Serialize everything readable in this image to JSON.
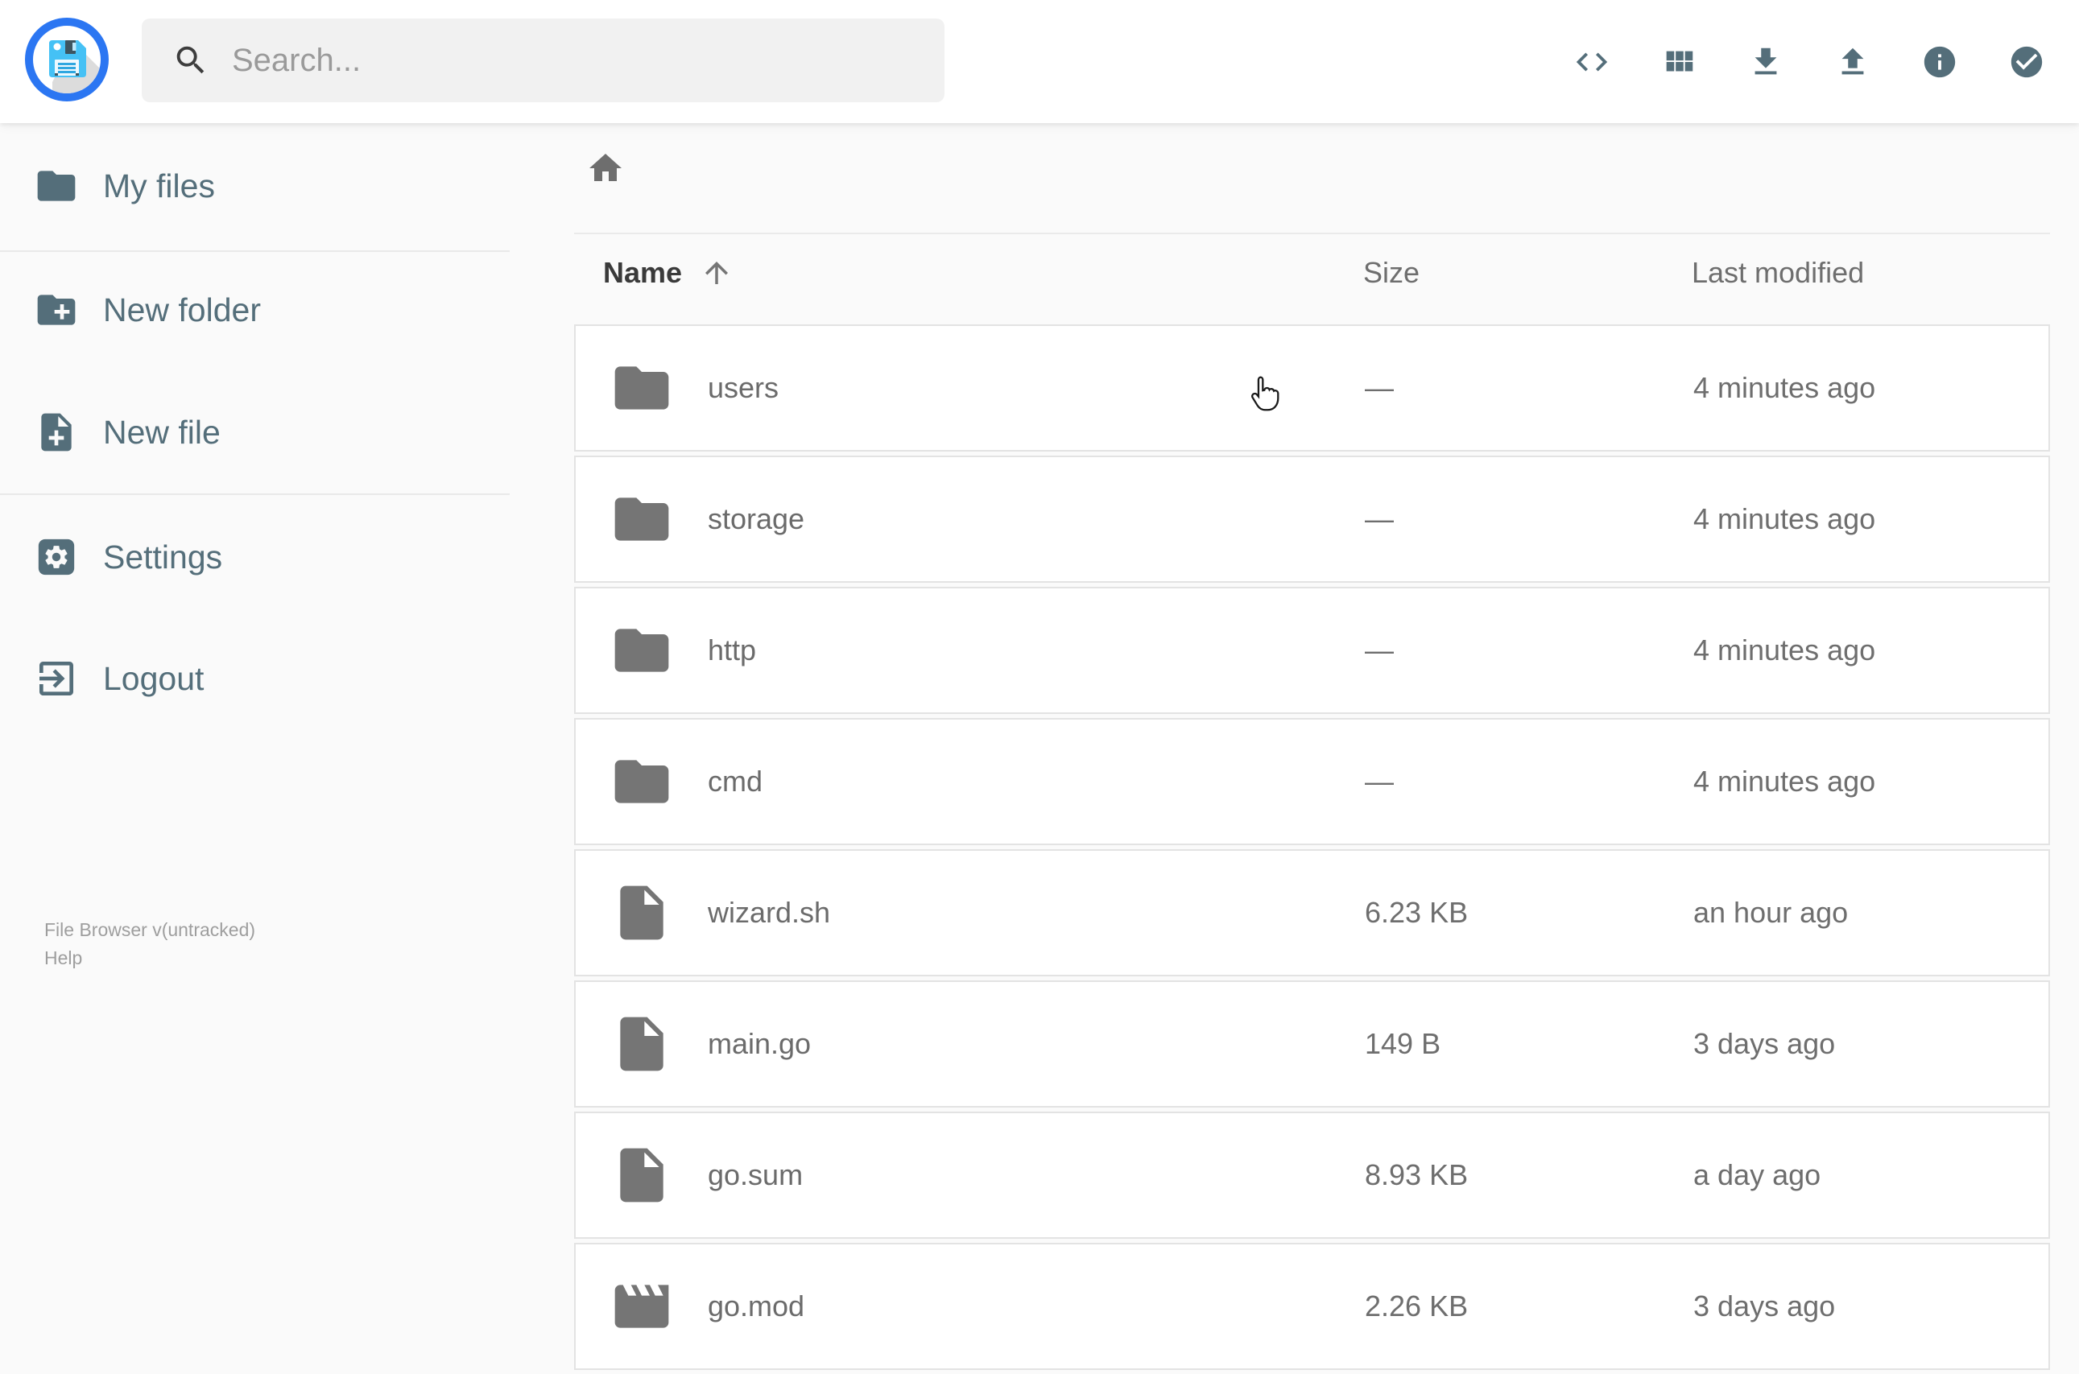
{
  "header": {
    "search": {
      "placeholder": "Search..."
    },
    "actions": [
      "code-icon",
      "grid-view-icon",
      "download-icon",
      "upload-icon",
      "info-icon",
      "select-icon"
    ]
  },
  "sidebar": {
    "items": [
      {
        "label": "My files",
        "icon": "folder-icon"
      },
      {
        "label": "New folder",
        "icon": "create-folder-icon"
      },
      {
        "label": "New file",
        "icon": "create-file-icon"
      },
      {
        "label": "Settings",
        "icon": "settings-icon"
      },
      {
        "label": "Logout",
        "icon": "logout-icon"
      }
    ],
    "footer": {
      "version": "File Browser v(untracked)",
      "help": "Help"
    }
  },
  "listing": {
    "columns": {
      "name": "Name",
      "size": "Size",
      "modified": "Last modified"
    },
    "sort": {
      "column": "Name",
      "direction": "asc"
    },
    "rows": [
      {
        "name": "users",
        "type": "folder",
        "size": "—",
        "modified": "4 minutes ago"
      },
      {
        "name": "storage",
        "type": "folder",
        "size": "—",
        "modified": "4 minutes ago"
      },
      {
        "name": "http",
        "type": "folder",
        "size": "—",
        "modified": "4 minutes ago"
      },
      {
        "name": "cmd",
        "type": "folder",
        "size": "—",
        "modified": "4 minutes ago"
      },
      {
        "name": "wizard.sh",
        "type": "file",
        "size": "6.23 KB",
        "modified": "an hour ago"
      },
      {
        "name": "main.go",
        "type": "file",
        "size": "149 B",
        "modified": "3 days ago"
      },
      {
        "name": "go.sum",
        "type": "file",
        "size": "8.93 KB",
        "modified": "a day ago"
      },
      {
        "name": "go.mod",
        "type": "movie",
        "size": "2.26 KB",
        "modified": "3 days ago"
      }
    ]
  },
  "colors": {
    "accent_blue": "#2b76f2",
    "floppy_blue": "#45c1f5",
    "slate": "#546e7a",
    "icon_gray": "#757575",
    "text_gray": "#6b6b6b",
    "background": "#fafafa"
  }
}
